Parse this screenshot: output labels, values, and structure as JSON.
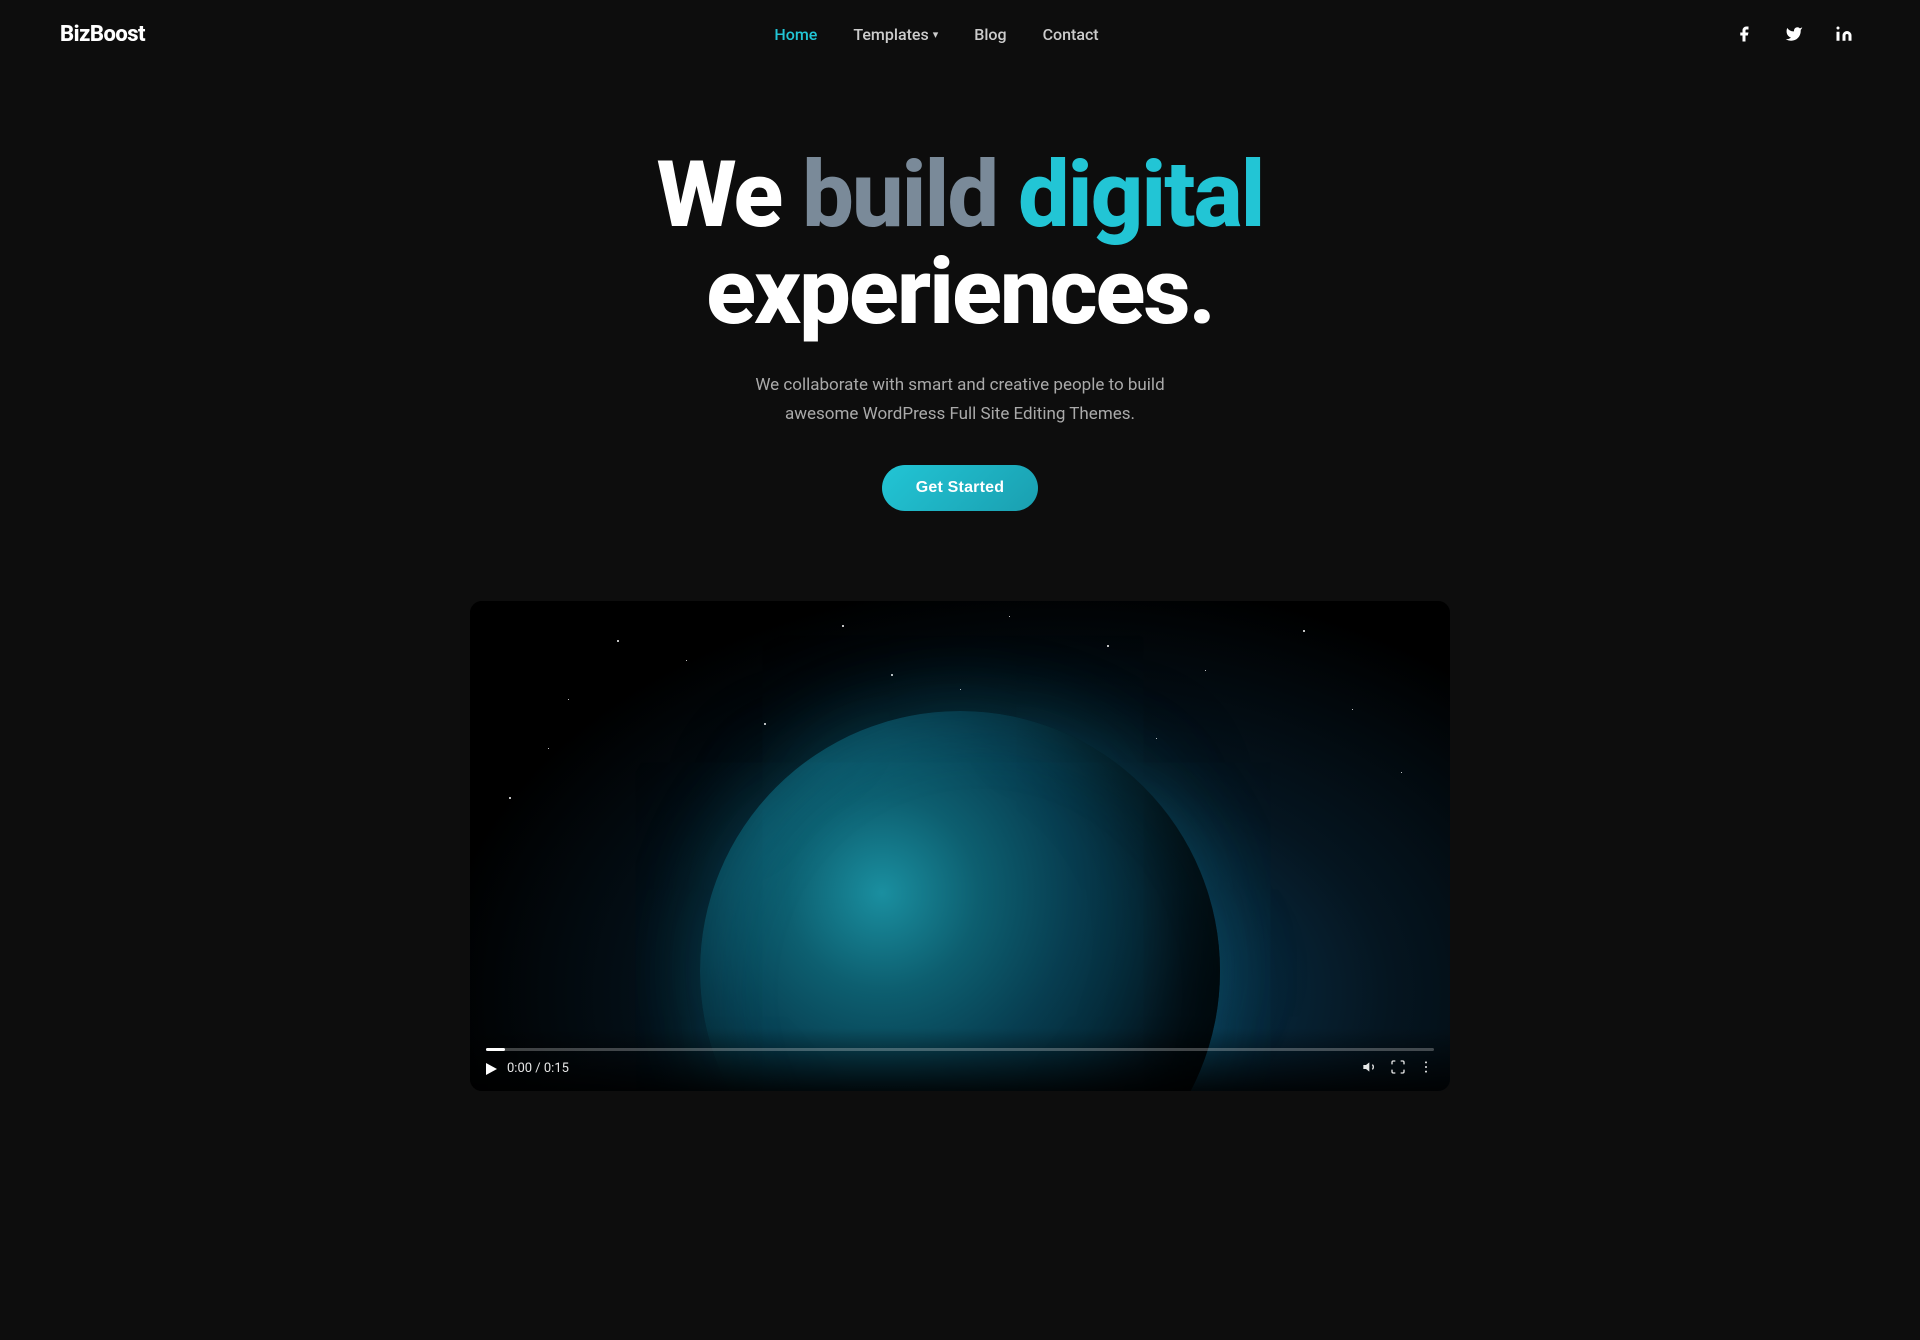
{
  "brand": {
    "name": "BizBoost"
  },
  "nav": {
    "links": [
      {
        "label": "Home",
        "active": true,
        "id": "home"
      },
      {
        "label": "Templates",
        "active": false,
        "id": "templates",
        "hasDropdown": true
      },
      {
        "label": "Blog",
        "active": false,
        "id": "blog"
      },
      {
        "label": "Contact",
        "active": false,
        "id": "contact"
      }
    ],
    "social": [
      {
        "id": "facebook",
        "icon": "f",
        "label": "Facebook"
      },
      {
        "id": "twitter",
        "icon": "t",
        "label": "Twitter"
      },
      {
        "id": "linkedin",
        "icon": "in",
        "label": "LinkedIn"
      }
    ]
  },
  "hero": {
    "line1_we": "We ",
    "line1_build": "build",
    "line1_digital": " digital",
    "line2": "experiences.",
    "subtitle_line1": "We collaborate with smart and creative people to build",
    "subtitle_line2": "awesome WordPress Full Site Editing Themes.",
    "cta_label": "Get Started"
  },
  "video": {
    "time_current": "0:00",
    "time_total": "0:15",
    "time_display": "0:00 / 0:15"
  }
}
